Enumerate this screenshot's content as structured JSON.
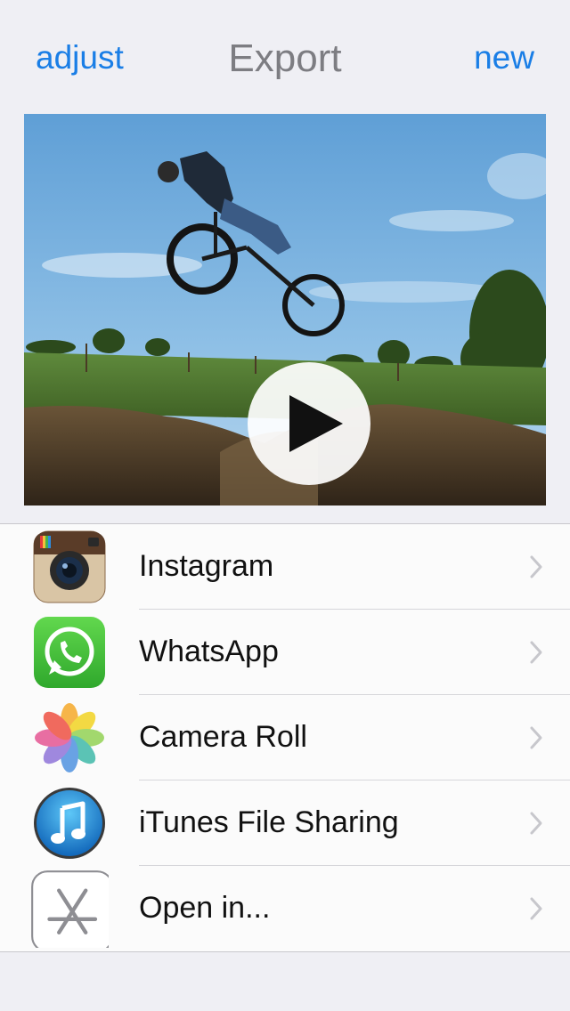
{
  "nav": {
    "left_label": "adjust",
    "title": "Export",
    "right_label": "new"
  },
  "preview": {
    "icon": "play-icon"
  },
  "export_options": [
    {
      "label": "Instagram",
      "icon": "instagram-icon"
    },
    {
      "label": "WhatsApp",
      "icon": "whatsapp-icon"
    },
    {
      "label": "Camera Roll",
      "icon": "photos-icon"
    },
    {
      "label": "iTunes File Sharing",
      "icon": "itunes-icon"
    },
    {
      "label": "Open in...",
      "icon": "app-store-icon"
    }
  ],
  "colors": {
    "accent": "#1a7ee6",
    "title": "#7d7d82",
    "background": "#efeff4"
  }
}
